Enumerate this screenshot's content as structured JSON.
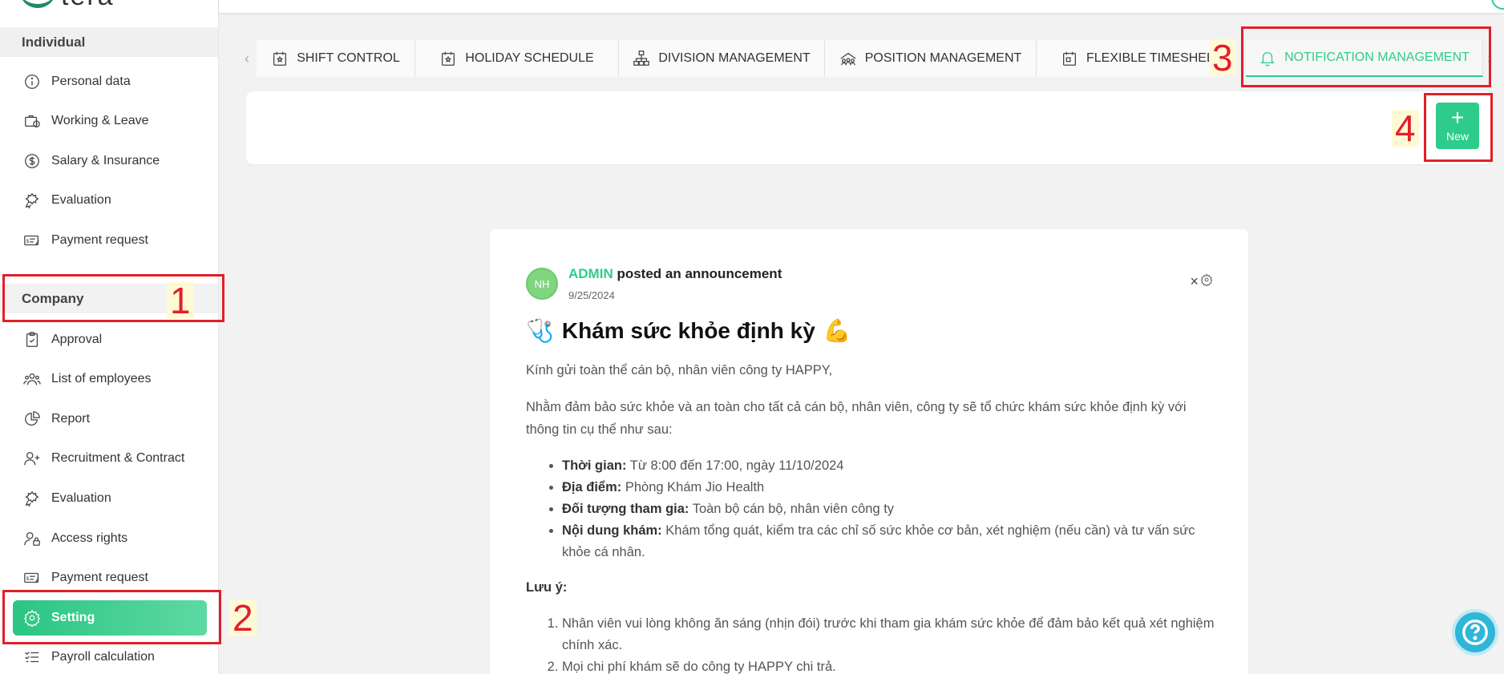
{
  "brand": {
    "logo_text": "tera"
  },
  "sidebar": {
    "individual_header": "Individual",
    "individual_items": [
      {
        "label": "Personal data",
        "icon": "info-icon"
      },
      {
        "label": "Working & Leave",
        "icon": "briefcase-clock-icon"
      },
      {
        "label": "Salary & Insurance",
        "icon": "dollar-icon"
      },
      {
        "label": "Evaluation",
        "icon": "evaluation-icon"
      },
      {
        "label": "Payment request",
        "icon": "payment-icon"
      }
    ],
    "company_header": "Company",
    "company_items": [
      {
        "label": "Approval",
        "icon": "clipboard-check-icon"
      },
      {
        "label": "List of employees",
        "icon": "users-icon"
      },
      {
        "label": "Report",
        "icon": "pie-chart-icon"
      },
      {
        "label": "Recruitment & Contract",
        "icon": "user-add-icon"
      },
      {
        "label": "Evaluation",
        "icon": "evaluation-icon"
      },
      {
        "label": "Access rights",
        "icon": "user-lock-icon"
      },
      {
        "label": "Payment request",
        "icon": "payment-icon"
      },
      {
        "label": "Setting",
        "icon": "gear-icon",
        "active": true
      },
      {
        "label": "Payroll calculation",
        "icon": "checklist-icon"
      }
    ]
  },
  "tabs": [
    {
      "label": "SHIFT CONTROL",
      "icon": "calendar-star-icon"
    },
    {
      "label": "HOLIDAY SCHEDULE",
      "icon": "calendar-star-icon"
    },
    {
      "label": "DIVISION MANAGEMENT",
      "icon": "org-chart-icon"
    },
    {
      "label": "POSITION MANAGEMENT",
      "icon": "position-icon"
    },
    {
      "label": "FLEXIBLE TIMESHEET",
      "icon": "calendar-icon"
    },
    {
      "label": "NOTIFICATION MANAGEMENT",
      "icon": "bell-icon",
      "active": true
    }
  ],
  "toolbar": {
    "new_label": "New",
    "new_plus": "+"
  },
  "post": {
    "avatar_initials": "NH",
    "author": "ADMIN",
    "action": " posted an announcement",
    "date": "9/25/2024",
    "close_symbol": "×",
    "title_emoji_left": "🩺",
    "title": "Khám sức khỏe định kỳ",
    "title_emoji_right": "💪",
    "greeting": "Kính gửi toàn thể cán bộ, nhân viên công ty HAPPY,",
    "intro": "Nhằm đảm bảo sức khỏe và an toàn cho tất cả cán bộ, nhân viên, công ty sẽ tổ chức khám sức khỏe định kỳ với thông tin cụ thể như sau:",
    "details": [
      {
        "key": "Thời gian:",
        "value": " Từ 8:00 đến 17:00, ngày 11/10/2024"
      },
      {
        "key": "Địa điểm:",
        "value": " Phòng Khám Jio Health"
      },
      {
        "key": "Đối tượng tham gia:",
        "value": " Toàn bộ cán bộ, nhân viên công ty"
      },
      {
        "key": "Nội dung khám:",
        "value": " Khám tổng quát, kiểm tra các chỉ số sức khỏe cơ bản, xét nghiệm (nếu cần) và tư vấn sức khỏe cá nhân."
      }
    ],
    "note_label": "Lưu ý:",
    "notes": [
      "Nhân viên vui lòng không ăn sáng (nhịn đói) trước khi tham gia khám sức khỏe để đảm bảo kết quả xét nghiệm chính xác.",
      "Mọi chi phí khám sẽ do công ty HAPPY chi trả."
    ]
  },
  "annotations": [
    "1",
    "2",
    "3",
    "4"
  ],
  "colors": {
    "accent": "#2ecc8a",
    "annotation": "#e0202a",
    "help": "#2fb6d9"
  }
}
